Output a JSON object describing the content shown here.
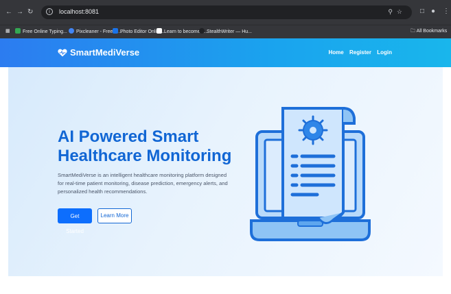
{
  "browser": {
    "url": "localhost:8081",
    "bookmarks": [
      {
        "label": "Free Online Typing...",
        "color": "#34a853"
      },
      {
        "label": "Pixcleaner - Free AI...",
        "color": "#4285f4"
      },
      {
        "label": "Photo Editor Online...",
        "color": "#1a73e8"
      },
      {
        "label": "Learn to become a...",
        "color": "#ffffff"
      },
      {
        "label": "StealthWriter — Hu...",
        "color": "#202124"
      }
    ],
    "all_bookmarks": "All Bookmarks"
  },
  "nav": {
    "brand": "SmartMediVerse",
    "links": [
      "Home",
      "Register",
      "Login"
    ]
  },
  "hero": {
    "title": "AI Powered Smart Healthcare Monitoring",
    "description": "SmartMediVerse is an intelligent healthcare monitoring platform designed for real-time patient monitoring, disease prediction, emergency alerts, and personalized health recommendations.",
    "primary_button": "Get Started",
    "secondary_button": "Learn More"
  },
  "colors": {
    "primary": "#0d6efd",
    "title": "#1166d4",
    "illustration_fill": "#8fc4f5",
    "illustration_stroke": "#1e6fd9"
  },
  "icons": [
    "back-arrow-icon",
    "forward-arrow-icon",
    "reload-icon",
    "site-info-icon",
    "zoom-icon",
    "star-icon",
    "heart-logo-icon",
    "laptop-document-virus-icon"
  ]
}
